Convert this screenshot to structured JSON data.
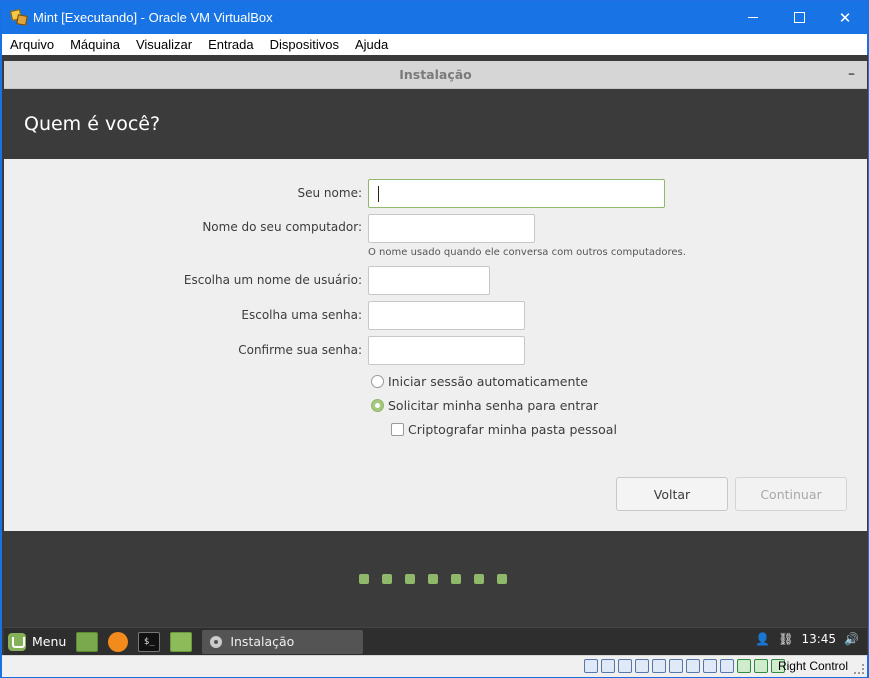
{
  "vbox": {
    "title": "Mint [Executando] - Oracle VM VirtualBox",
    "menu": [
      "Arquivo",
      "Máquina",
      "Visualizar",
      "Entrada",
      "Dispositivos",
      "Ajuda"
    ],
    "status_host_key": "Right Control"
  },
  "installer": {
    "window_title": "Instalação",
    "minimize_glyph": "–",
    "heading": "Quem é você?",
    "labels": {
      "name": "Seu nome:",
      "computer": "Nome do seu computador:",
      "username": "Escolha um nome de usuário:",
      "password": "Escolha uma senha:",
      "confirm": "Confirme sua senha:"
    },
    "values": {
      "name": "",
      "computer": "",
      "username": "",
      "password": "",
      "confirm": ""
    },
    "computer_hint": "O nome usado quando ele conversa com outros computadores.",
    "options": {
      "auto_login": "Iniciar sessão automaticamente",
      "require_password": "Solicitar minha senha para entrar",
      "encrypt_home": "Criptografar minha pasta pessoal"
    },
    "login_mode": "require_password",
    "encrypt_home_checked": false,
    "buttons": {
      "back": "Voltar",
      "continue": "Continuar"
    },
    "slides_count": 7,
    "accent_color": "#8fb86b"
  },
  "panel": {
    "menu_label": "Menu",
    "terminal_glyph": "$_",
    "task_label": "Instalação",
    "clock": "13:45"
  }
}
